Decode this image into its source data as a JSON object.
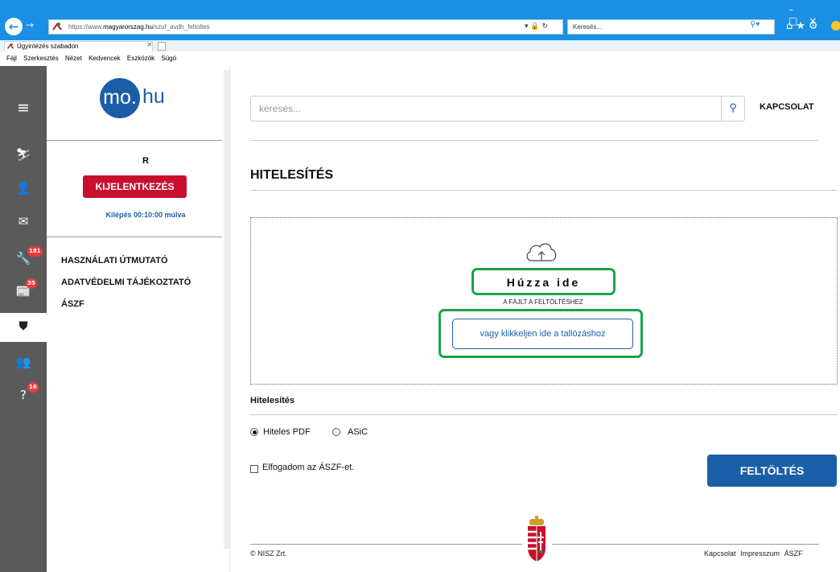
{
  "browser": {
    "url_prefix": "https://www.",
    "url_domain": "magyarorszag.hu",
    "url_path": "/szuf_avdh_feltoltes",
    "search_placeholder": "Keresés...",
    "tab_title": "Ügyintézés szabadon",
    "menu": [
      "Fájl",
      "Szerkesztés",
      "Nézet",
      "Kedvencek",
      "Eszközök",
      "Súgó"
    ]
  },
  "rail": {
    "badges": {
      "tools": "181",
      "news": "35",
      "help": "16"
    }
  },
  "sidebar": {
    "logo_circle": "mo.",
    "logo_suffix": "hu",
    "user_initial": "R",
    "logout_label": "KIJELENTKEZÉS",
    "countdown": "Kilépés 00:10:00 múlva",
    "links": [
      "HASZNÁLATI ÚTMUTATÓ",
      "ADATVÉDELMI TÁJÉKOZTATÓ",
      "ÁSZF"
    ]
  },
  "header": {
    "search_placeholder": "keresés...",
    "contact": "KAPCSOLAT"
  },
  "main": {
    "title": "HITELESÍTÉS",
    "dropzone": {
      "drag_text": "Húzza ide",
      "sub_text": "A FÁJLT A FELTÖLTÉSHEZ",
      "browse_label": "vagy klikkeljen ide a tallózáshoz"
    },
    "auth_section_label": "Hitelesítés",
    "options": [
      {
        "label": "Hiteles PDF",
        "selected": true
      },
      {
        "label": "ASiC",
        "selected": false
      }
    ],
    "accept_label": "Elfogadom az ÁSZF-et.",
    "upload_label": "FELTÖLTÉS"
  },
  "footer": {
    "copyright": "© NISZ Zrt.",
    "links": [
      "Kapcsolat",
      "Impresszum",
      "ÁSZF"
    ]
  },
  "colors": {
    "brand_blue": "#1b5ea8",
    "logout_red": "#c8102e",
    "highlight_green": "#1aa34a",
    "rail_gray": "#5a5a5a",
    "ie_blue": "#1a8fe3"
  }
}
